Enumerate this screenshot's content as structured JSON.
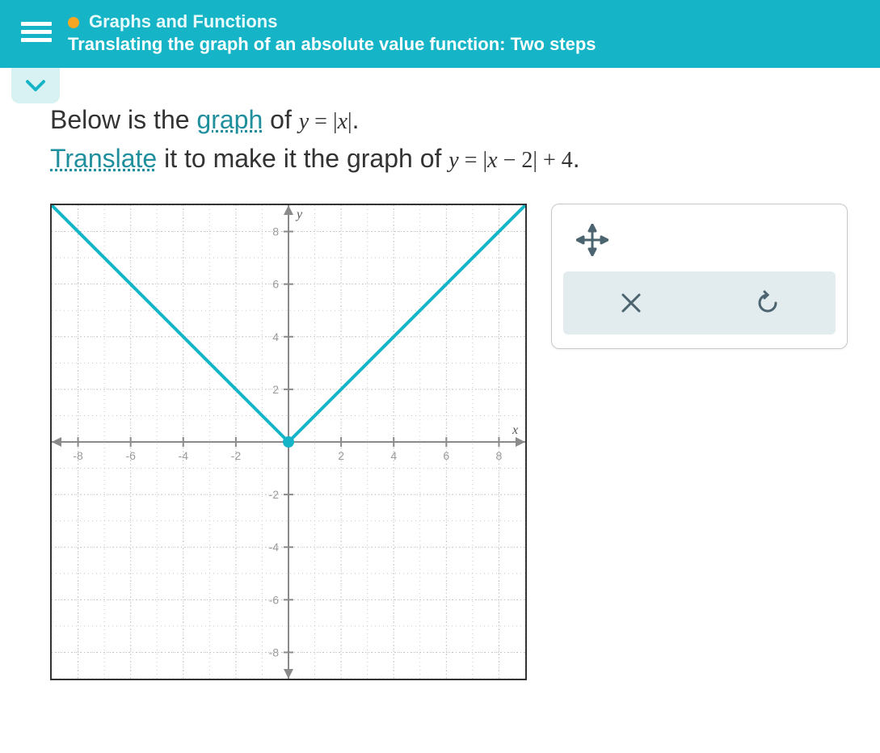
{
  "header": {
    "category": "Graphs and Functions",
    "topic": "Translating the graph of an absolute value function: Two steps"
  },
  "prompt": {
    "line1_prefix": "Below is the ",
    "keyword1": "graph",
    "line1_mid": " of ",
    "eq1": "y = |x|",
    "line1_end": ".",
    "keyword2": "Translate",
    "line2_mid": " it to make it the graph of ",
    "eq2": "y = |x − 2| + 4",
    "line2_end": "."
  },
  "chart_data": {
    "type": "line",
    "title": "",
    "xlabel": "x",
    "ylabel": "y",
    "xlim": [
      -9,
      9
    ],
    "ylim": [
      -9,
      9
    ],
    "xticks": [
      -8,
      -6,
      -4,
      -2,
      2,
      4,
      6,
      8
    ],
    "yticks": [
      -8,
      -6,
      -4,
      -2,
      2,
      4,
      6,
      8
    ],
    "series": [
      {
        "name": "y=|x|",
        "x": [
          -9,
          0,
          9
        ],
        "y": [
          9,
          0,
          9
        ],
        "vertex": [
          0,
          0
        ]
      }
    ]
  },
  "tools": {
    "move": "move-tool",
    "delete": "delete-tool",
    "reset": "reset-tool"
  }
}
